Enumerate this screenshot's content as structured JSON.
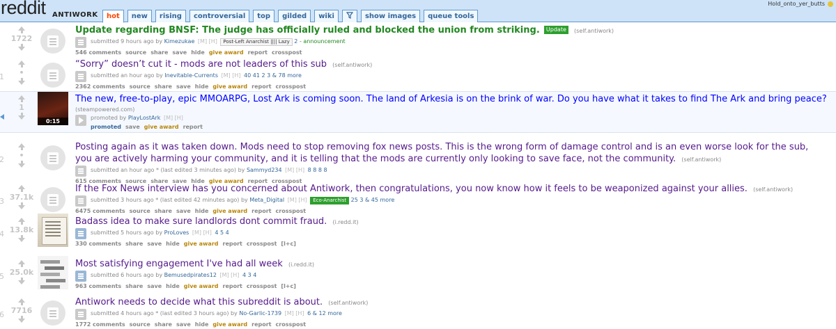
{
  "header": {
    "logo": "reddit",
    "subreddit": "ANTIWORK",
    "tabs": [
      "hot",
      "new",
      "rising",
      "controversial",
      "top",
      "gilded",
      "wiki"
    ],
    "filter_icon": "funnel-icon",
    "extra_tabs": [
      "show images",
      "queue tools"
    ],
    "username": "Hold_onto_yer_butts"
  },
  "posts": [
    {
      "rank": "",
      "score": "1722",
      "title": "Update regarding BNSF: The judge has officially ruled and blocked the union from striking.",
      "post_flair": "Update",
      "domain": "(self.antiwork)",
      "submitted": "submitted 9 hours ago by",
      "author": "Kimezukae",
      "mod_tags": "[M] [H]",
      "user_flair": "Post-Left Anarchist |||| Lazy",
      "awards": "2",
      "extra": "- announcement",
      "comments": "546 comments",
      "actions": [
        "source",
        "share",
        "save",
        "hide",
        "give award",
        "report",
        "crosspost"
      ]
    },
    {
      "rank": "1",
      "score": "•",
      "title": "“Sorry” doesn’t cut it - mods are not leaders of this sub",
      "domain": "(self.antiwork)",
      "submitted": "submitted an hour ago by",
      "author": "Inevitable-Currents",
      "mod_tags": "[M] [H]",
      "awards": "40  41  2  3  & 78 more",
      "comments": "2362 comments",
      "actions": [
        "source",
        "share",
        "save",
        "hide",
        "give award",
        "report",
        "crosspost"
      ]
    },
    {
      "rank": "",
      "score": "1",
      "title": "The new, free-to-play, epic MMOARPG, Lost Ark is coming soon. The land of Arkesia is on the brink of war. Do you have what it takes to find The Ark and bring peace?",
      "domain": "(steampowered.com)",
      "thumb_duration": "0:15",
      "submitted": "promoted by",
      "author": "PlayLostArk",
      "mod_tags": "[M] [H]",
      "promoted_label": "promoted",
      "actions": [
        "save",
        "give award",
        "report"
      ]
    },
    {
      "rank": "2",
      "score": "•",
      "title": "Posting again as it was taken down. Mods need to stop removing fox news posts. This is the wrong form of damage control and is an even worse look for the sub, you are actively harming your community, and it is telling that the mods are currently only looking to save face, not the community.",
      "domain": "(self.antiwork)",
      "submitted": "submitted an hour ago * (last edited 3 minutes ago) by",
      "author": "Sammyd234",
      "mod_tags": "[M] [H]",
      "awards": "8  8  8  8",
      "comments": "615 comments",
      "actions": [
        "source",
        "share",
        "save",
        "hide",
        "give award",
        "report",
        "crosspost"
      ]
    },
    {
      "rank": "3",
      "score": "37.1k",
      "title": "If the Fox News interview has you concerned about Antiwork, then congratulations, you now know how it feels to be weaponized against your allies.",
      "domain": "(self.antiwork)",
      "submitted": "submitted 3 hours ago * (last edited 42 minutes ago) by",
      "author": "Meta_Digital",
      "mod_tags": "[M] [H]",
      "user_flair": "Eco-Anarchist",
      "awards": "25  3  & 45 more",
      "comments": "6475 comments",
      "actions": [
        "source",
        "share",
        "save",
        "hide",
        "give award",
        "report",
        "crosspost"
      ]
    },
    {
      "rank": "4",
      "score": "13.8k",
      "title": "Badass idea to make sure landlords dont commit fraud.",
      "domain": "(i.redd.it)",
      "submitted": "submitted 5 hours ago by",
      "author": "ProLoves",
      "mod_tags": "[M] [H]",
      "awards": "4  5  4",
      "comments": "330 comments",
      "actions": [
        "share",
        "save",
        "hide",
        "give award",
        "report",
        "crosspost",
        "[l+c]"
      ]
    },
    {
      "rank": "5",
      "score": "25.0k",
      "title": "Most satisfying engagement I've had all week",
      "domain": "(i.redd.it)",
      "submitted": "submitted 6 hours ago by",
      "author": "Bemusedpirates12",
      "mod_tags": "[M] [H]",
      "awards": "4  3  4",
      "comments": "963 comments",
      "actions": [
        "share",
        "save",
        "hide",
        "give award",
        "report",
        "crosspost",
        "[l+c]"
      ]
    },
    {
      "rank": "6",
      "score": "7716",
      "title": "Antiwork needs to decide what this subreddit is about.",
      "domain": "(self.antiwork)",
      "submitted": "submitted 4 hours ago * (last edited 3 hours ago) by",
      "author": "No-Garlic-1739",
      "mod_tags": "[M] [H]",
      "awards": "6  & 12 more",
      "comments": "1772 comments",
      "actions": [
        "source",
        "share",
        "save",
        "hide",
        "give award",
        "report",
        "crosspost"
      ]
    }
  ],
  "colors": {
    "header_bg": "#cee3f8",
    "link": "#0000ff",
    "visited": "#551a8b",
    "sticky": "#228822",
    "selected_tab": "#ff4500"
  }
}
